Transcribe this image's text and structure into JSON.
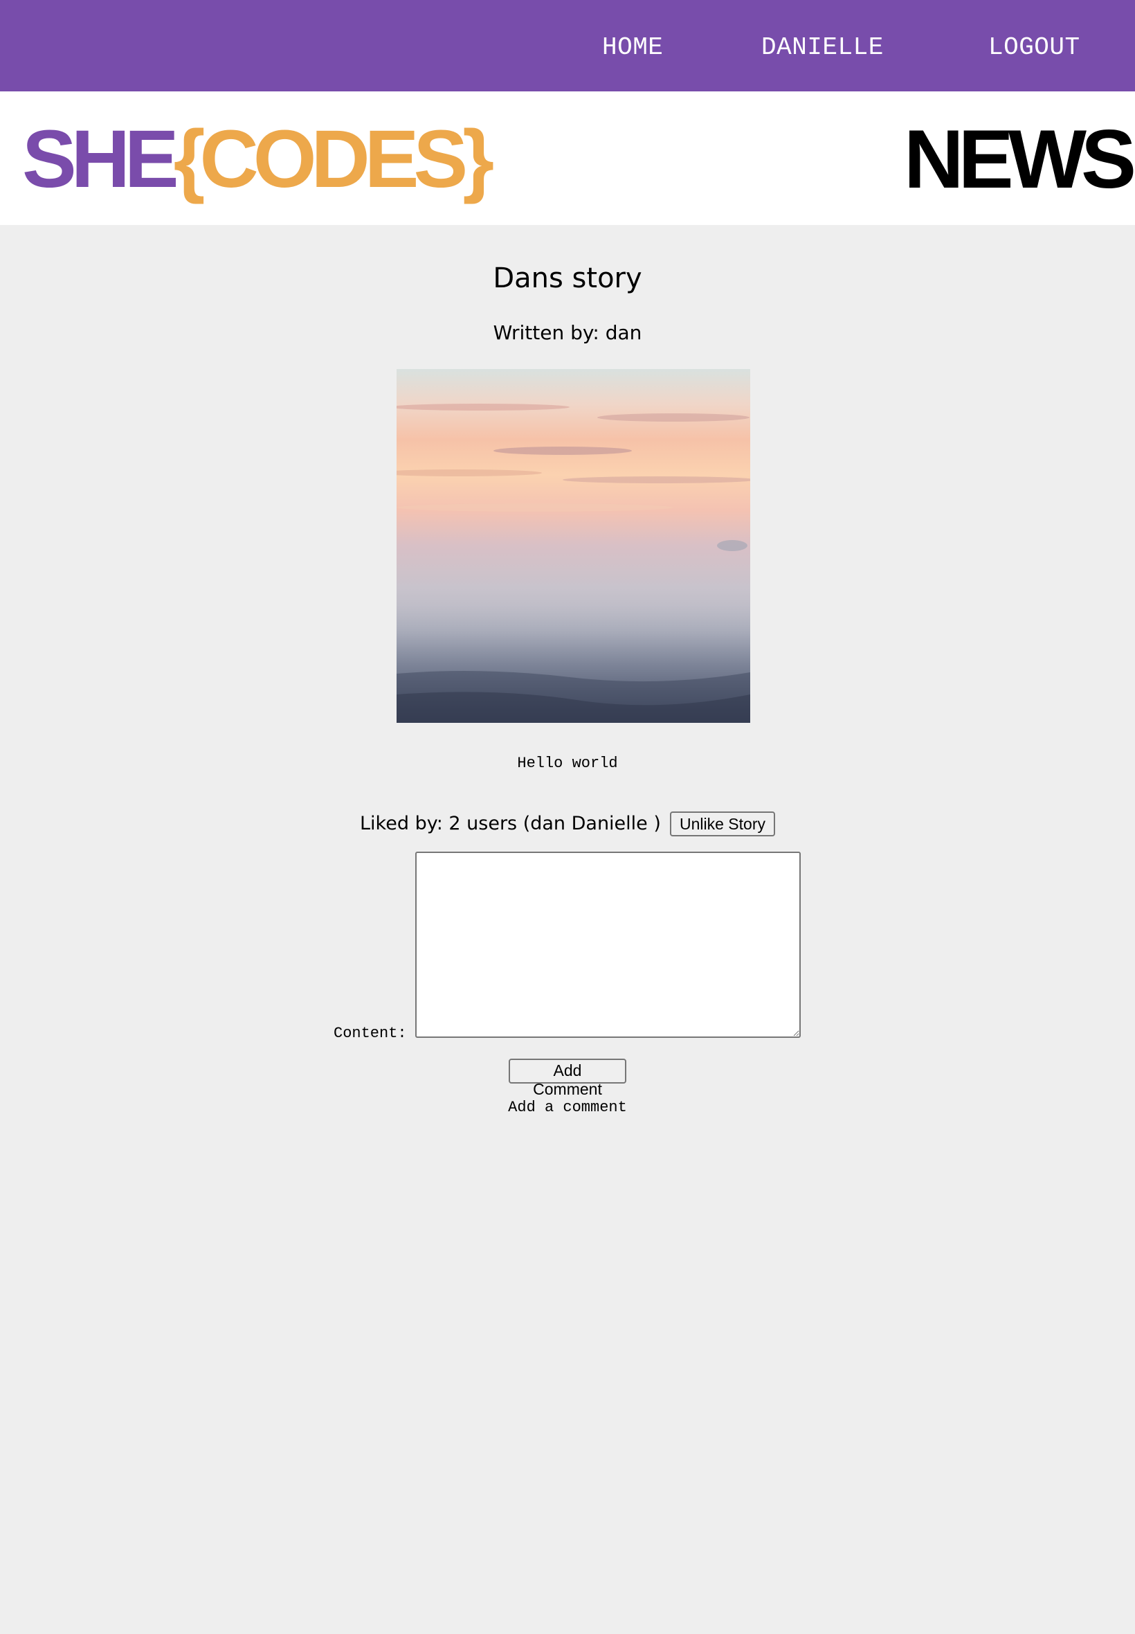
{
  "nav": {
    "home_label": "HOME",
    "user_label": "DANIELLE",
    "logout_label": "LOGOUT",
    "background_color": "#784dab"
  },
  "brand": {
    "logo_part1": "SHE",
    "logo_part2": "{CODES}",
    "logo_part1_color": "#7a4cab",
    "logo_part2_color": "#eda84b",
    "news_label": "NEWS"
  },
  "story": {
    "title": "Dans story",
    "author": "Written by: dan",
    "content": "Hello world",
    "image_icon": "foggy-sunrise-photo"
  },
  "likes": {
    "text": "Liked by: 2 users (dan Danielle )",
    "unlike_label": "Unlike Story"
  },
  "comment_form": {
    "content_label": "Content:",
    "content_value": "",
    "submit_label": "Add Comment",
    "note": "Add a comment"
  }
}
